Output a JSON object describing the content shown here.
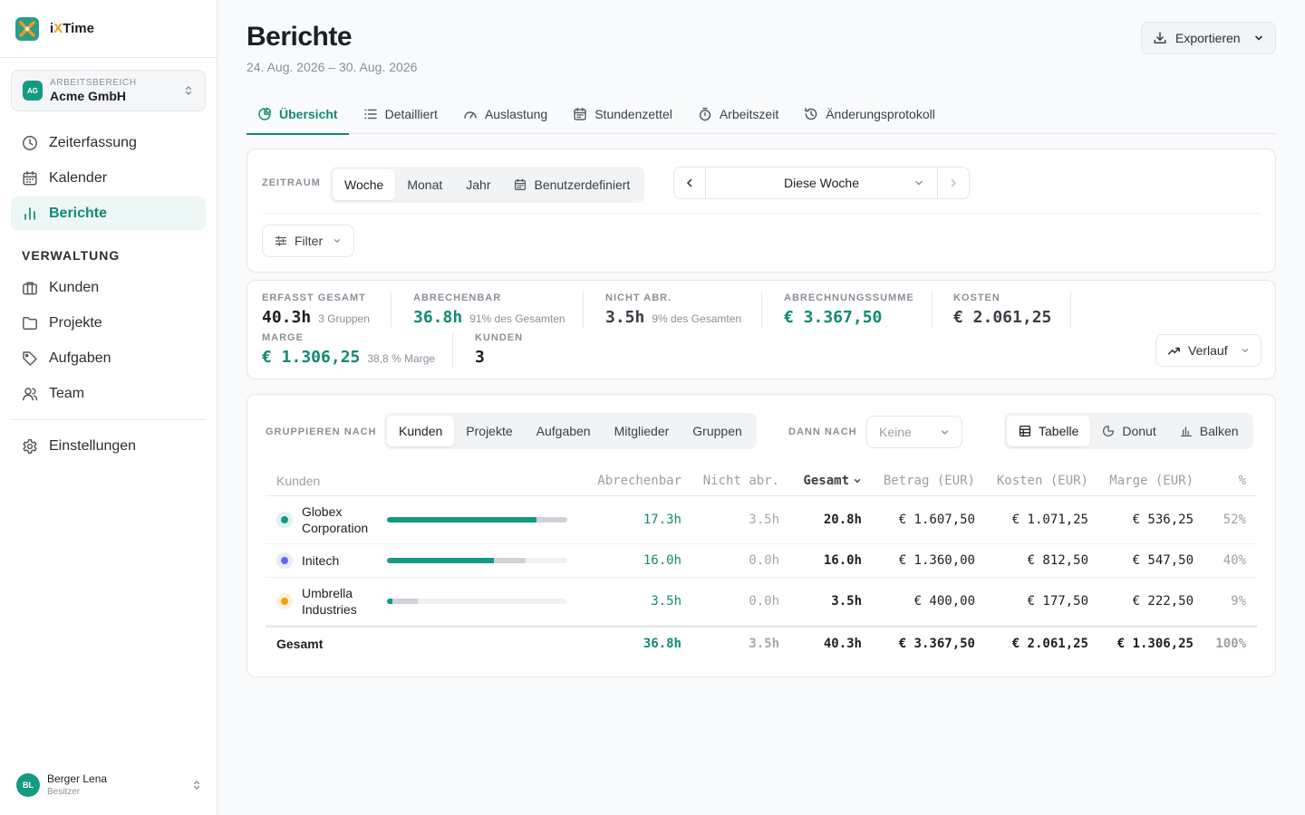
{
  "brand": {
    "name_prefix": "i",
    "name_x": "X",
    "name_suffix": "Time"
  },
  "workspace": {
    "badge": "AG",
    "label": "ARBEITSBEREICH",
    "name": "Acme GmbH"
  },
  "nav": {
    "main": [
      {
        "label": "Zeiterfassung",
        "icon": "clock-icon"
      },
      {
        "label": "Kalender",
        "icon": "calendar-icon"
      },
      {
        "label": "Berichte",
        "icon": "bar-chart-icon",
        "active": true
      }
    ],
    "section": "VERWALTUNG",
    "admin": [
      {
        "label": "Kunden",
        "icon": "briefcase-icon"
      },
      {
        "label": "Projekte",
        "icon": "folder-icon"
      },
      {
        "label": "Aufgaben",
        "icon": "tag-icon"
      },
      {
        "label": "Team",
        "icon": "users-icon"
      }
    ],
    "settings": {
      "label": "Einstellungen",
      "icon": "gear-icon"
    }
  },
  "user": {
    "initials": "BL",
    "name": "Berger Lena",
    "role": "Besitzer"
  },
  "header": {
    "title": "Berichte",
    "subtitle": "24. Aug. 2026 – 30. Aug. 2026",
    "export_label": "Exportieren"
  },
  "tabs": [
    {
      "label": "Übersicht",
      "icon": "pie-icon",
      "active": true
    },
    {
      "label": "Detailliert",
      "icon": "list-icon"
    },
    {
      "label": "Auslastung",
      "icon": "gauge-icon"
    },
    {
      "label": "Stundenzettel",
      "icon": "calendar-icon"
    },
    {
      "label": "Arbeitszeit",
      "icon": "stopwatch-icon"
    },
    {
      "label": "Änderungsprotokoll",
      "icon": "history-icon"
    }
  ],
  "period": {
    "label": "ZEITRAUM",
    "options": [
      "Woche",
      "Monat",
      "Jahr",
      "Benutzerdefiniert"
    ],
    "selected": "Woche",
    "range_value": "Diese Woche",
    "filter_label": "Filter"
  },
  "stats": {
    "total": {
      "label": "ERFASST GESAMT",
      "value": "40.3h",
      "note": "3 Gruppen"
    },
    "billable": {
      "label": "ABRECHENBAR",
      "value": "36.8h",
      "note": "91% des Gesamten"
    },
    "nonbillable": {
      "label": "NICHT ABR.",
      "value": "3.5h",
      "note": "9% des Gesamten"
    },
    "amount": {
      "label": "ABRECHNUNGSSUMME",
      "value": "€ 3.367,50"
    },
    "costs": {
      "label": "KOSTEN",
      "value": "€ 2.061,25"
    },
    "margin": {
      "label": "MARGE",
      "value": "€ 1.306,25",
      "note": "38,8 % Marge"
    },
    "clients": {
      "label": "KUNDEN",
      "value": "3"
    },
    "trend_label": "Verlauf"
  },
  "grouping": {
    "group_label": "GRUPPIEREN NACH",
    "group_options": [
      "Kunden",
      "Projekte",
      "Aufgaben",
      "Mitglieder",
      "Gruppen"
    ],
    "group_selected": "Kunden",
    "then_label": "DANN NACH",
    "then_value": "Keine",
    "views": [
      "Tabelle",
      "Donut",
      "Balken"
    ],
    "view_selected": "Tabelle"
  },
  "table": {
    "headers": [
      "Kunden",
      "Abrechenbar",
      "Nicht abr.",
      "Gesamt",
      "Betrag (EUR)",
      "Kosten (EUR)",
      "Marge (EUR)",
      "%"
    ],
    "rows": [
      {
        "name": "Globex Corporation",
        "color": "#149a80",
        "ring": "#e1f3ef",
        "billable_share": 0.83,
        "bar_total": 1.0,
        "billable": "17.3h",
        "nonbillable": "3.5h",
        "total": "20.8h",
        "amount": "€ 1.607,50",
        "costs": "€ 1.071,25",
        "margin": "€ 536,25",
        "pct": "52%"
      },
      {
        "name": "Initech",
        "color": "#6366f1",
        "ring": "#ebebfd",
        "billable_share": 0.77,
        "bar_total": 0.77,
        "billable": "16.0h",
        "nonbillable": "0.0h",
        "total": "16.0h",
        "amount": "€ 1.360,00",
        "costs": "€ 812,50",
        "margin": "€ 547,50",
        "pct": "40%"
      },
      {
        "name": "Umbrella Industries",
        "color": "#f59e0b",
        "ring": "#fdf1dc",
        "billable_share": 0.17,
        "bar_total": 0.17,
        "billable": "3.5h",
        "nonbillable": "0.0h",
        "total": "3.5h",
        "amount": "€ 400,00",
        "costs": "€ 177,50",
        "margin": "€ 222,50",
        "pct": "9%"
      }
    ],
    "total": {
      "label": "Gesamt",
      "billable": "36.8h",
      "nonbillable": "3.5h",
      "total": "40.3h",
      "amount": "€ 3.367,50",
      "costs": "€ 2.061,25",
      "margin": "€ 1.306,25",
      "pct": "100%"
    }
  },
  "colors": {
    "accent": "#128a73",
    "brand_orange": "#f29a1e"
  }
}
